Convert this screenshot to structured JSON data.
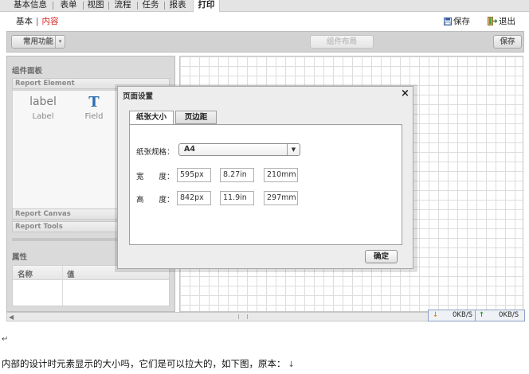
{
  "top_tabs": [
    "基本信息",
    "表单",
    "视图",
    "流程",
    "任务",
    "报表",
    "打印"
  ],
  "active_tab": "打印",
  "breadcrumb": {
    "first": "基本",
    "separator": "|",
    "second": "内容"
  },
  "header_actions": {
    "save": "保存",
    "exit": "退出"
  },
  "toolbar": {
    "common_functions": "常用功能",
    "middle_button": "组件布局",
    "save": "保存"
  },
  "left_panel": {
    "title": "组件面板",
    "report_element": "Report Element",
    "elements": [
      {
        "glyph": "label",
        "label": "Label"
      },
      {
        "glyph": "T",
        "label": "Field"
      }
    ],
    "report_canvas": "Report Canvas",
    "report_tools": "Report Tools",
    "properties_title": "属性",
    "properties_columns": [
      "名称",
      "值"
    ]
  },
  "dialog": {
    "title": "页面设置",
    "close": "×",
    "tabs": [
      "纸张大小",
      "页边距"
    ],
    "active_tab": "纸张大小",
    "paper_label": "纸张规格：",
    "paper_value": "A4",
    "dropdown_arrow": "▼",
    "width_label": "宽　　度：",
    "width_values": [
      "595px",
      "8.27in",
      "210mm"
    ],
    "height_label": "高　　度：",
    "height_values": [
      "842px",
      "11.9in",
      "297mm"
    ],
    "ok": "确定"
  },
  "status": {
    "down_speed": "0KB/S",
    "up_speed": "0KB/S"
  },
  "doc_text": {
    "paragraph_mark": "↵",
    "paragraph": "内部的设计时元素显示的大小吗，它们是可以拉大的，如下图，原本：",
    "return_mark": "↓"
  },
  "colors": {
    "accent_red": "#d6201d",
    "status_border": "#8aa0c4"
  }
}
